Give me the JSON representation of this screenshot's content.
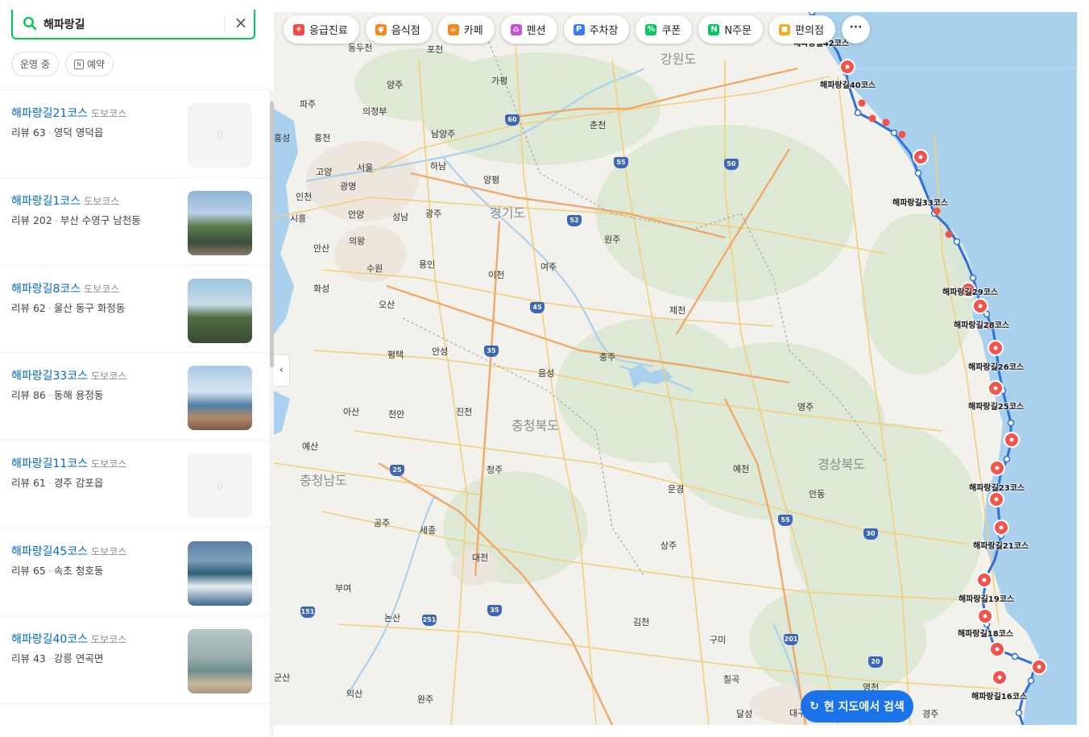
{
  "search": {
    "query": "해파랑길"
  },
  "filters": [
    {
      "label": "운영 중",
      "icon": ""
    },
    {
      "label": "예약",
      "icon": "calendar-icon"
    }
  ],
  "results": [
    {
      "name": "해파랑길21코스",
      "category": "도보코스",
      "reviews": "리뷰 63",
      "address": "영덕 영덕읍",
      "thumbnail": "placeholder"
    },
    {
      "name": "해파랑길1코스",
      "category": "도보코스",
      "reviews": "리뷰 202",
      "address": "부산 수영구 남천동",
      "thumbnail": "photo-coast-cliff"
    },
    {
      "name": "해파랑길8코스",
      "category": "도보코스",
      "reviews": "리뷰 62",
      "address": "울산 동구 화정동",
      "thumbnail": "photo-lighthouse"
    },
    {
      "name": "해파랑길33코스",
      "category": "도보코스",
      "reviews": "리뷰 86",
      "address": "동해 용정동",
      "thumbnail": "photo-beach"
    },
    {
      "name": "해파랑길11코스",
      "category": "도보코스",
      "reviews": "리뷰 61",
      "address": "경주 감포읍",
      "thumbnail": "placeholder"
    },
    {
      "name": "해파랑길45코스",
      "category": "도보코스",
      "reviews": "리뷰 65",
      "address": "속초 청호동",
      "thumbnail": "photo-waves"
    },
    {
      "name": "해파랑길40코스",
      "category": "도보코스",
      "reviews": "리뷰 43",
      "address": "강릉 연곡면",
      "thumbnail": "photo-sea-breakwater"
    }
  ],
  "categories": [
    {
      "label": "응급진료",
      "icon": "hospital-icon",
      "color": "#f04b4b"
    },
    {
      "label": "음식점",
      "icon": "fork-icon",
      "color": "#f08a24"
    },
    {
      "label": "카페",
      "icon": "cup-icon",
      "color": "#f08a24"
    },
    {
      "label": "펜션",
      "icon": "bed-icon",
      "color": "#c84fd8"
    },
    {
      "label": "주차장",
      "icon": "parking-icon",
      "color": "#3a7bf0"
    },
    {
      "label": "쿠폰",
      "icon": "coupon-icon",
      "color": "#03c75a"
    },
    {
      "label": "N주문",
      "icon": "order-icon",
      "color": "#03c75a"
    },
    {
      "label": "편의점",
      "icon": "store-icon",
      "color": "#f0b020"
    }
  ],
  "more_label": "···",
  "map_search_button": "현 지도에서 검색",
  "regions": [
    "강원도",
    "경기도",
    "충청북도",
    "경상북도",
    "충청남도"
  ],
  "cities": [
    "동두천",
    "포천",
    "양주",
    "가평",
    "파주",
    "의정부",
    "남양주",
    "춘천",
    "홍천",
    "고양",
    "서울",
    "하남",
    "양평",
    "인천",
    "광명",
    "시흥",
    "안양",
    "성남",
    "광주",
    "원주",
    "안산",
    "의왕",
    "수원",
    "용인",
    "이천",
    "여주",
    "화성",
    "오산",
    "제천",
    "평택",
    "안성",
    "충주",
    "음성",
    "아산",
    "천안",
    "진천",
    "영주",
    "예산",
    "청주",
    "예천",
    "안동",
    "문경",
    "공주",
    "세종",
    "대전",
    "상주",
    "부여",
    "논산",
    "김천",
    "구미",
    "칠곡",
    "익산",
    "완주",
    "영천",
    "달성",
    "대구",
    "경주",
    "군산",
    "홍성"
  ],
  "course_labels": [
    "해파랑길40코스",
    "해파랑길33코스",
    "해파랑길29코스",
    "해파랑길28코스",
    "해파랑길26코스",
    "해파랑길25코스",
    "해파랑길23코스",
    "해파랑길21코스",
    "해파랑길19코스",
    "해파랑길18코스",
    "해파랑길16코스",
    "해파랑길42코스"
  ],
  "highways": [
    "60",
    "55",
    "50",
    "52",
    "45",
    "35",
    "25",
    "55",
    "30",
    "151",
    "251",
    "35",
    "201",
    "20"
  ]
}
